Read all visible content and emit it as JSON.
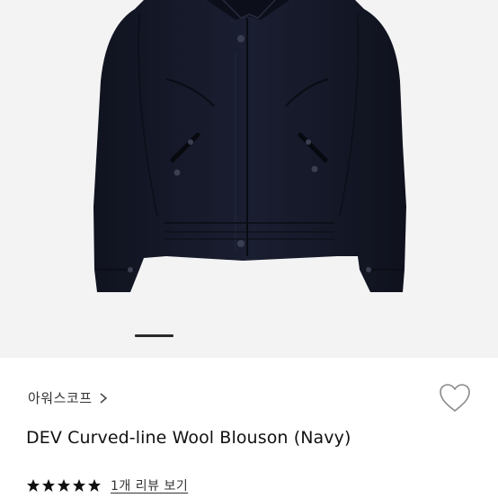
{
  "product": {
    "brand": "아워스코프",
    "name": "DEV Curved-line Wool Blouson (Navy)",
    "review_link": "1개 리뷰 보기",
    "rating": 5,
    "rating_max": 5
  },
  "gallery": {
    "slide_index": 1
  },
  "icons": {
    "brand_chevron": "chevron-right-icon",
    "wishlist": "heart-outline-icon",
    "star": "star-filled-icon"
  },
  "colors": {
    "jacket": "#15192a",
    "gallery_bg": "#f3f3f4",
    "text": "#111111",
    "indicator": "#2a2a2a"
  }
}
